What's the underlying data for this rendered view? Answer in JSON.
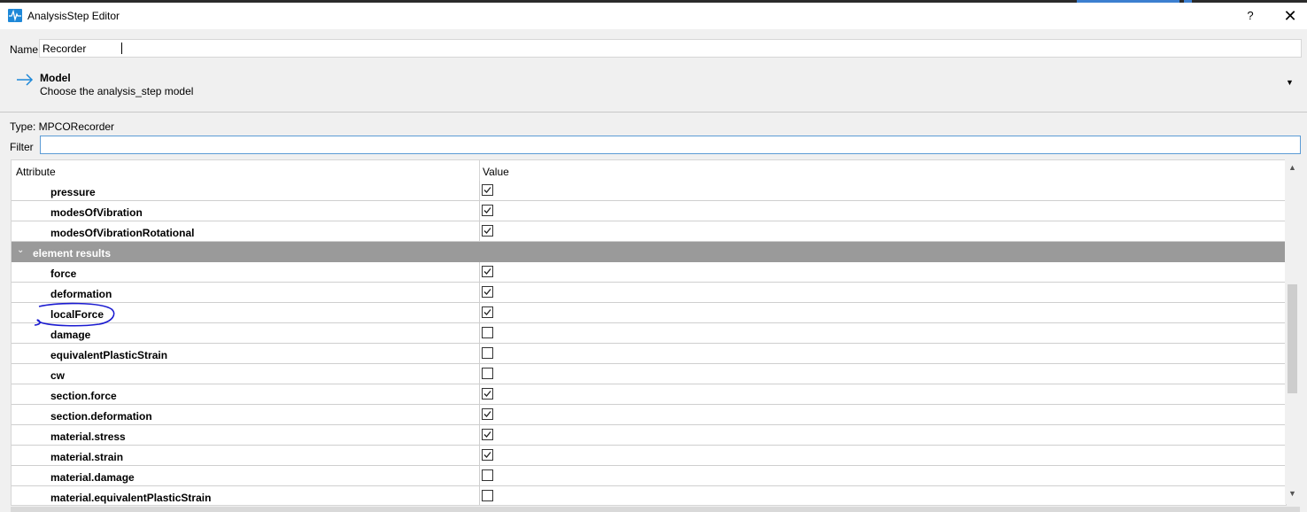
{
  "window": {
    "title": "AnalysisStep Editor",
    "help_label": "?",
    "close_label": "✕",
    "icon": "app-waveform-icon"
  },
  "name_field": {
    "label": "Name",
    "value": "Recorder"
  },
  "model": {
    "title": "Model",
    "description": "Choose the analysis_step model",
    "arrow_icon": "arrow-right-icon",
    "dropdown_icon": "▼"
  },
  "type_line": "Type:  MPCORecorder",
  "filter": {
    "label": "Filter",
    "value": ""
  },
  "table": {
    "col_attribute": "Attribute",
    "col_value": "Value",
    "rows_top": [
      {
        "label": "pressure",
        "checked": true
      },
      {
        "label": "modesOfVibration",
        "checked": true
      },
      {
        "label": "modesOfVibrationRotational",
        "checked": true
      }
    ],
    "group": {
      "label": "element results",
      "expanded": true
    },
    "rows": [
      {
        "label": "force",
        "checked": true
      },
      {
        "label": "deformation",
        "checked": true
      },
      {
        "label": "localForce",
        "checked": true
      },
      {
        "label": "damage",
        "checked": false
      },
      {
        "label": "equivalentPlasticStrain",
        "checked": false
      },
      {
        "label": "cw",
        "checked": false
      },
      {
        "label": "section.force",
        "checked": true
      },
      {
        "label": "section.deformation",
        "checked": true
      },
      {
        "label": "material.stress",
        "checked": true
      },
      {
        "label": "material.strain",
        "checked": true
      },
      {
        "label": "material.damage",
        "checked": false
      },
      {
        "label": "material.equivalentPlasticStrain",
        "checked": false
      }
    ]
  },
  "scrollbar": {
    "position_fraction": 0.5
  },
  "colors": {
    "accent": "#1e88d8",
    "group_bg": "#9a9a9a",
    "annotation": "#1a1ad0"
  }
}
